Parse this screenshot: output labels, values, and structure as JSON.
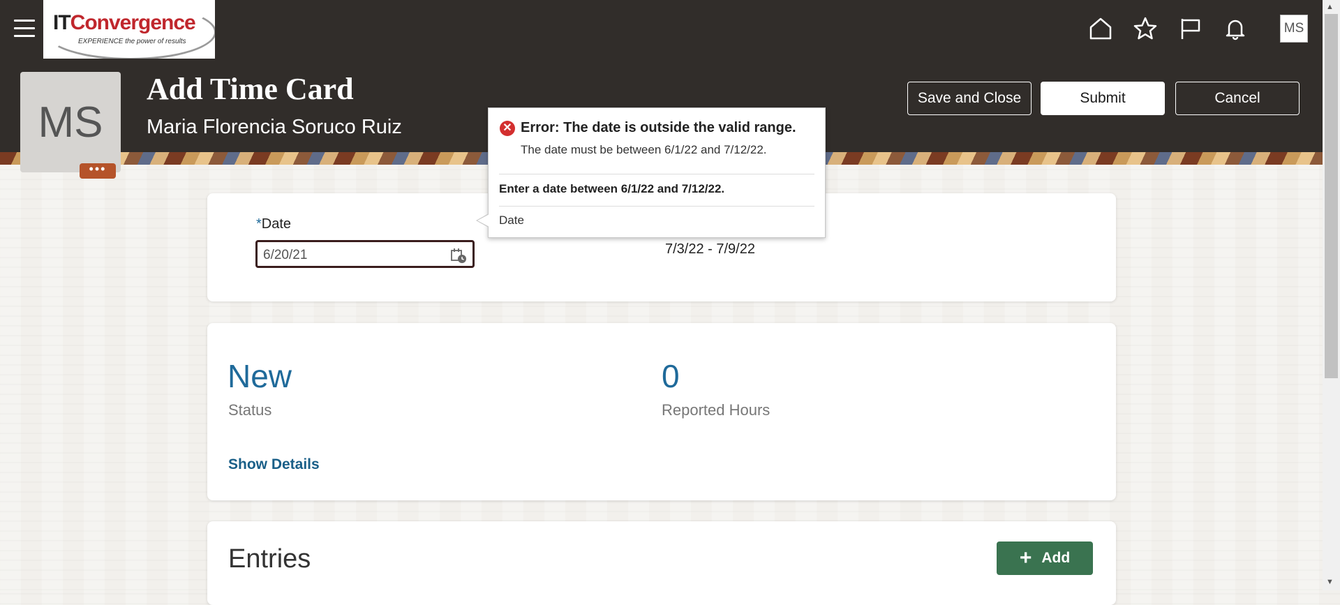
{
  "header": {
    "logo_text_it": "IT",
    "logo_text_conv": "Convergence",
    "logo_tagline": "EXPERIENCE the power of results",
    "user_initials": "MS"
  },
  "page": {
    "title": "Add Time Card",
    "person_name": "Maria Florencia Soruco Ruiz",
    "avatar_initials": "MS",
    "avatar_more": "•••"
  },
  "actions": {
    "save_close": "Save and Close",
    "submit": "Submit",
    "cancel": "Cancel"
  },
  "form": {
    "date_required_mark": "*",
    "date_label": "Date",
    "date_value": "6/20/21",
    "period_value": "7/3/22 - 7/9/22"
  },
  "error_popup": {
    "title": "Error: The date is outside the valid range.",
    "message": "The date must be between 6/1/22 and 7/12/22.",
    "hint": "Enter a date between 6/1/22 and 7/12/22.",
    "field_label": "Date"
  },
  "summary": {
    "status_value": "New",
    "status_label": "Status",
    "hours_value": "0",
    "hours_label": "Reported Hours",
    "show_details": "Show Details"
  },
  "entries": {
    "title": "Entries",
    "add_label": "Add"
  },
  "colors": {
    "header_bg": "#312d2a",
    "accent_blue": "#1f6a9a",
    "add_green": "#3a7350",
    "error_red": "#d32f2f"
  }
}
